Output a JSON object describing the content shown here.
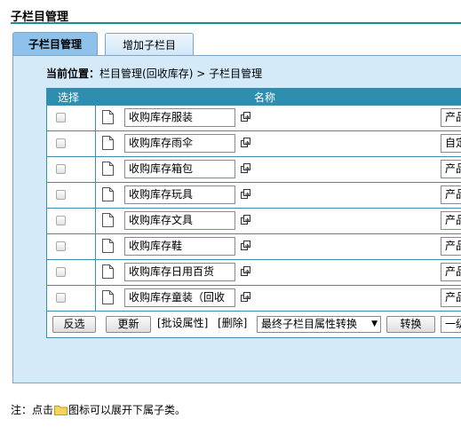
{
  "page": {
    "title": "子栏目管理"
  },
  "tabs": [
    {
      "label": "子栏目管理"
    },
    {
      "label": "增加子栏目"
    }
  ],
  "breadcrumb": {
    "label": "当前位置：",
    "path": "栏目管理(回收库存) > 子栏目管理"
  },
  "table": {
    "headers": {
      "select": "选择",
      "name": "名称"
    },
    "rows": [
      {
        "name": "收购库存服装",
        "type": "产品"
      },
      {
        "name": "收购库存雨伞",
        "type": "自定"
      },
      {
        "name": "收购库存箱包",
        "type": "产品"
      },
      {
        "name": "收购库存玩具",
        "type": "产品"
      },
      {
        "name": "收购库存文具",
        "type": "产品"
      },
      {
        "name": "收购库存鞋",
        "type": "产品"
      },
      {
        "name": "收购库存日用百货",
        "type": "产品"
      },
      {
        "name": "收购库存童装（回收",
        "type": "产品"
      }
    ]
  },
  "footer": {
    "invert_label": "反选",
    "update_label": "更新",
    "batch_attr_label": "[批设属性]",
    "delete_label": "[删除]",
    "convert_select": "最终子栏目属性转换",
    "convert_label": "转换",
    "extra_select": "一级"
  },
  "note": {
    "prefix": "注：点击",
    "suffix": "图标可以展开下属子类。"
  }
}
